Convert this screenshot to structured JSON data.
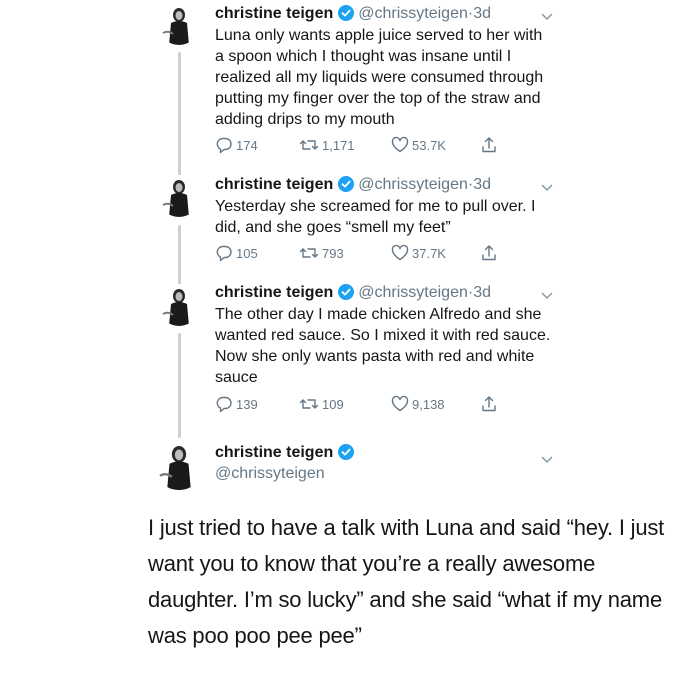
{
  "tweets": [
    {
      "name": "christine teigen",
      "handle": "@chrissyteigen",
      "dot": "·",
      "time": "3d",
      "text": "Luna only wants apple juice served to her with a spoon which I thought was insane until I realized all my liquids were consumed through putting my finger over the top of the straw and adding drips to my mouth",
      "replies": "174",
      "retweets": "1,171",
      "likes": "53.7K"
    },
    {
      "name": "christine teigen",
      "handle": "@chrissyteigen",
      "dot": "·",
      "time": "3d",
      "text": "Yesterday she screamed for me to pull over. I did, and she goes “smell my feet”",
      "replies": "105",
      "retweets": "793",
      "likes": "37.7K"
    },
    {
      "name": "christine teigen",
      "handle": "@chrissyteigen",
      "dot": "·",
      "time": "3d",
      "text": "The other day I made chicken Alfredo and she wanted red sauce. So I mixed it with red sauce. Now she only wants pasta with red and white sauce",
      "replies": "139",
      "retweets": "109",
      "likes": "9,138"
    }
  ],
  "main_tweet": {
    "name": "christine teigen",
    "handle": "@chrissyteigen",
    "text": "I just tried to have a talk with Luna and said “hey. I just want you to know that you’re a really awesome daughter. I’m so lucky” and she said “what if my name was poo poo pee pee”"
  },
  "colors": {
    "text": "#14171a",
    "secondary": "#657786",
    "verified": "#1da1f2",
    "thread_line": "#c8d1d8"
  },
  "icons": [
    "verified-badge-icon",
    "chevron-down-icon",
    "reply-icon",
    "retweet-icon",
    "like-icon",
    "share-icon"
  ]
}
